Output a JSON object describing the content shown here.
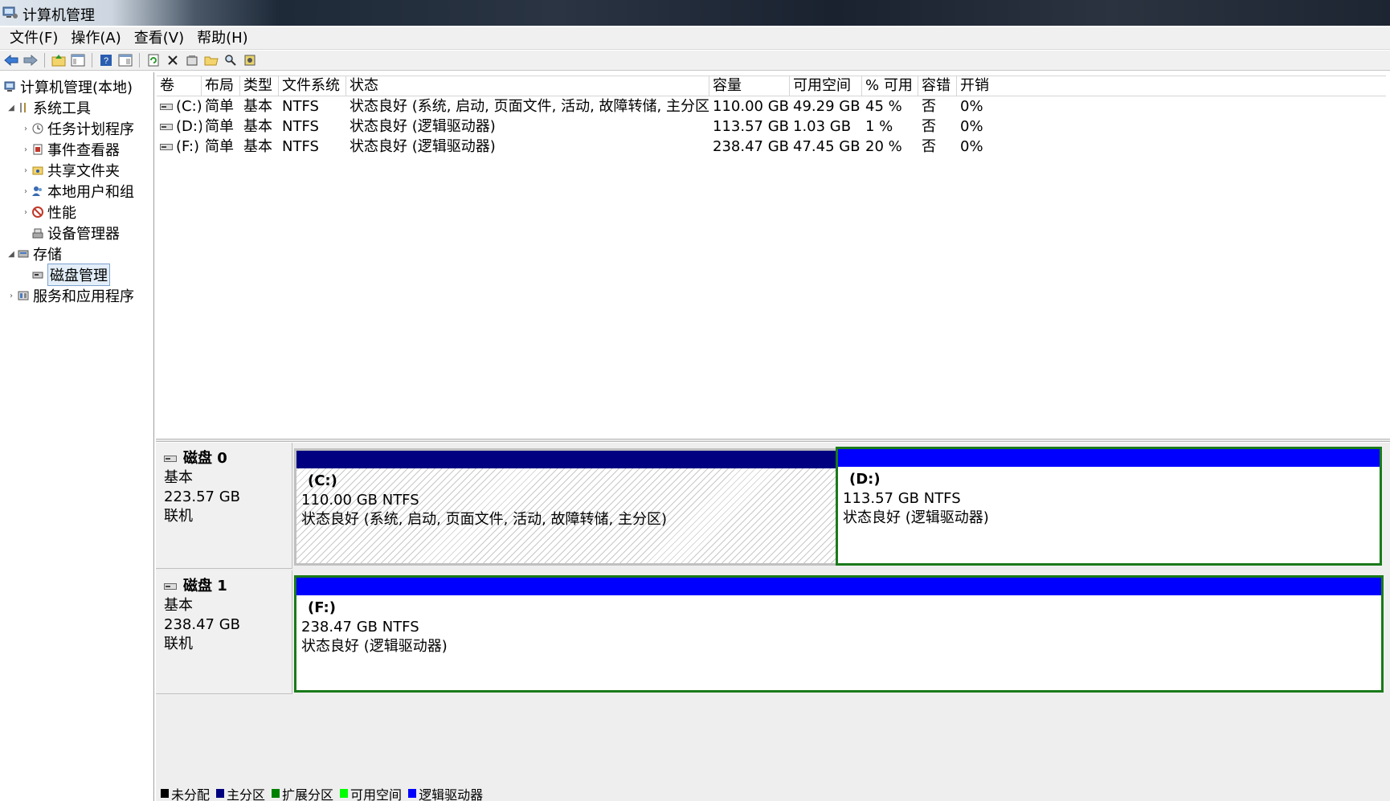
{
  "window": {
    "title": "计算机管理"
  },
  "menu": [
    "文件(F)",
    "操作(A)",
    "查看(V)",
    "帮助(H)"
  ],
  "toolbar": {
    "icons": [
      "back-arrow-icon",
      "forward-arrow-icon",
      "up-folder-icon",
      "show-hide-tree-icon",
      "help-icon",
      "properties-pane-icon",
      "refresh-icon",
      "delete-icon",
      "properties-icon",
      "open-icon",
      "search-icon",
      "settings-icon"
    ]
  },
  "tree": {
    "root": "计算机管理(本地)",
    "system_tools": "系统工具",
    "task_scheduler": "任务计划程序",
    "event_viewer": "事件查看器",
    "shared_folders": "共享文件夹",
    "local_users": "本地用户和组",
    "performance": "性能",
    "device_manager": "设备管理器",
    "storage": "存储",
    "disk_management": "磁盘管理",
    "services_apps": "服务和应用程序"
  },
  "volumes": {
    "headers": [
      "卷",
      "布局",
      "类型",
      "文件系统",
      "状态",
      "容量",
      "可用空间",
      "% 可用",
      "容错",
      "开销"
    ],
    "rows": [
      {
        "vol": "(C:)",
        "layout": "简单",
        "type": "基本",
        "fs": "NTFS",
        "status": "状态良好 (系统, 启动, 页面文件, 活动, 故障转储, 主分区)",
        "capacity": "110.00 GB",
        "free": "49.29 GB",
        "pct": "45 %",
        "fault": "否",
        "overhead": "0%"
      },
      {
        "vol": "(D:)",
        "layout": "简单",
        "type": "基本",
        "fs": "NTFS",
        "status": "状态良好 (逻辑驱动器)",
        "capacity": "113.57 GB",
        "free": "1.03 GB",
        "pct": "1 %",
        "fault": "否",
        "overhead": "0%"
      },
      {
        "vol": "(F:)",
        "layout": "简单",
        "type": "基本",
        "fs": "NTFS",
        "status": "状态良好 (逻辑驱动器)",
        "capacity": "238.47 GB",
        "free": "47.45 GB",
        "pct": "20 %",
        "fault": "否",
        "overhead": "0%"
      }
    ]
  },
  "disks": [
    {
      "name": "磁盘 0",
      "kind": "基本",
      "size": "223.57 GB",
      "state": "联机",
      "partitions": [
        {
          "name": "(C:)",
          "size_fs": "110.00 GB NTFS",
          "status": "状态良好 (系统, 启动, 页面文件, 活动, 故障转储, 主分区)",
          "bar_color": "#000080"
        },
        {
          "name": "(D:)",
          "size_fs": "113.57 GB NTFS",
          "status": "状态良好 (逻辑驱动器)",
          "bar_color": "#0000ff"
        }
      ]
    },
    {
      "name": "磁盘 1",
      "kind": "基本",
      "size": "238.47 GB",
      "state": "联机",
      "partitions": [
        {
          "name": "(F:)",
          "size_fs": "238.47 GB NTFS",
          "status": "状态良好 (逻辑驱动器)",
          "bar_color": "#0000ff"
        }
      ]
    }
  ],
  "legend": [
    {
      "label": "未分配",
      "color": "#000000"
    },
    {
      "label": "主分区",
      "color": "#000080"
    },
    {
      "label": "扩展分区",
      "color": "#008000"
    },
    {
      "label": "可用空间",
      "color": "#00ff00"
    },
    {
      "label": "逻辑驱动器",
      "color": "#0000ff"
    }
  ]
}
